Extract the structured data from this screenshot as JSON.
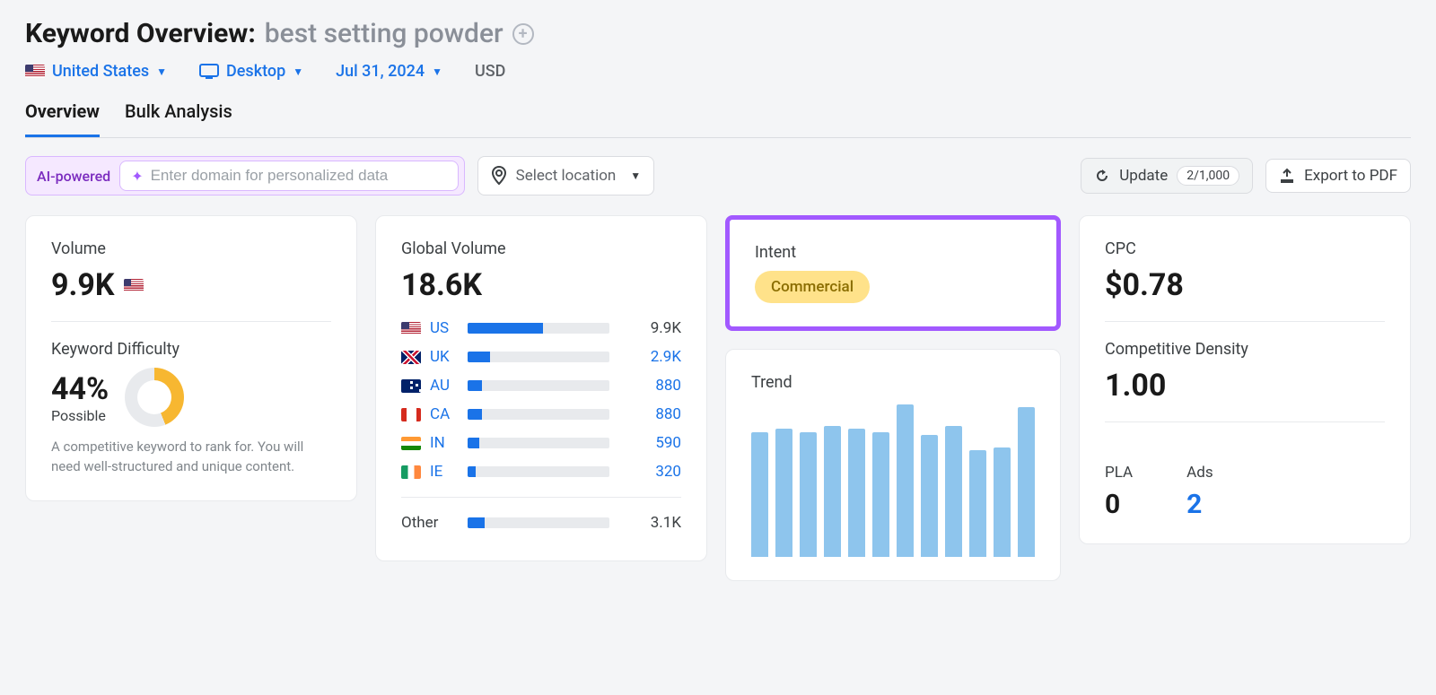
{
  "header": {
    "title_prefix": "Keyword Overview:",
    "keyword": "best setting powder"
  },
  "filters": {
    "country": "United States",
    "device": "Desktop",
    "date": "Jul 31, 2024",
    "currency": "USD"
  },
  "tabs": {
    "overview": "Overview",
    "bulk": "Bulk Analysis"
  },
  "controls": {
    "ai_label": "AI-powered",
    "domain_placeholder": "Enter domain for personalized data",
    "location_label": "Select location",
    "update_label": "Update",
    "update_count": "2/1,000",
    "export_label": "Export to PDF"
  },
  "volume": {
    "title": "Volume",
    "value": "9.9K",
    "kd_title": "Keyword Difficulty",
    "kd_value": "44%",
    "kd_label": "Possible",
    "kd_desc": "A competitive keyword to rank for. You will need well-structured and unique content."
  },
  "global_volume": {
    "title": "Global Volume",
    "value": "18.6K",
    "rows": [
      {
        "code": "US",
        "flag": "flag-us",
        "value": "9.9K",
        "pct": 53,
        "link": false
      },
      {
        "code": "UK",
        "flag": "flag-uk",
        "value": "2.9K",
        "pct": 16,
        "link": true
      },
      {
        "code": "AU",
        "flag": "flag-au",
        "value": "880",
        "pct": 10,
        "link": true
      },
      {
        "code": "CA",
        "flag": "flag-ca",
        "value": "880",
        "pct": 10,
        "link": true
      },
      {
        "code": "IN",
        "flag": "flag-in",
        "value": "590",
        "pct": 8,
        "link": true
      },
      {
        "code": "IE",
        "flag": "flag-ie",
        "value": "320",
        "pct": 6,
        "link": true
      }
    ],
    "other_label": "Other",
    "other_value": "3.1K",
    "other_pct": 12
  },
  "intent": {
    "title": "Intent",
    "badge": "Commercial"
  },
  "trend": {
    "title": "Trend"
  },
  "cpc": {
    "title": "CPC",
    "value": "$0.78",
    "density_title": "Competitive Density",
    "density_value": "1.00",
    "pla_label": "PLA",
    "pla_value": "0",
    "ads_label": "Ads",
    "ads_value": "2"
  },
  "chart_data": {
    "type": "bar",
    "title": "Trend",
    "categories": [
      "1",
      "2",
      "3",
      "4",
      "5",
      "6",
      "7",
      "8",
      "9",
      "10",
      "11",
      "12"
    ],
    "values": [
      82,
      84,
      82,
      86,
      84,
      82,
      100,
      80,
      86,
      70,
      72,
      98
    ],
    "xlabel": "",
    "ylabel": "",
    "ylim": [
      0,
      100
    ]
  }
}
